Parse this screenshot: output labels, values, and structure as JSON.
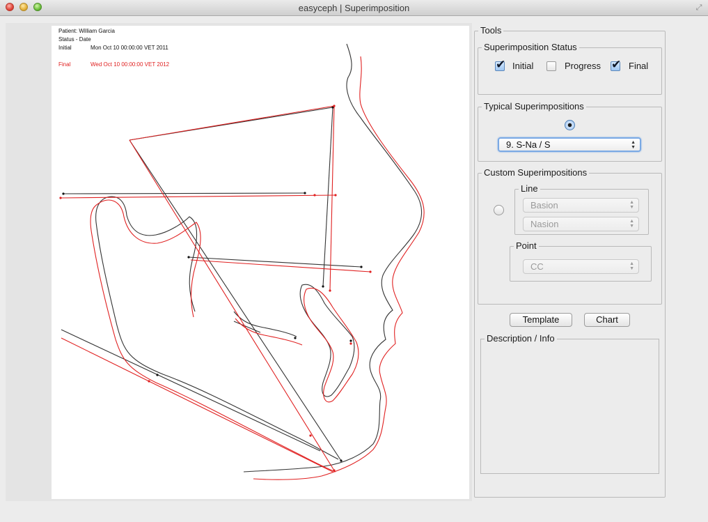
{
  "window": {
    "title": "easyceph | Superimposition"
  },
  "tracing": {
    "patient_line": "Patient: William Garcia",
    "status_line": "Status  -  Date",
    "initial_label": "Initial",
    "initial_date": "Mon Oct 10 00:00:00 VET 2011",
    "final_label": "Final",
    "final_date": "Wed Oct 10 00:00:00 VET 2012",
    "colors": {
      "initial": "#333333",
      "final": "#e02020"
    }
  },
  "tools": {
    "title": "Tools",
    "status": {
      "title": "Superimposition Status",
      "initial": {
        "label": "Initial",
        "checked": true
      },
      "progress": {
        "label": "Progress",
        "checked": false
      },
      "final": {
        "label": "Final",
        "checked": true
      }
    },
    "typical": {
      "title": "Typical Superimpositions",
      "selected": true,
      "value": "9. S-Na / S"
    },
    "custom": {
      "title": "Custom Superimpositions",
      "selected": false,
      "line_title": "Line",
      "line_from": "Basion",
      "line_to": "Nasion",
      "point_title": "Point",
      "point_value": "CC"
    },
    "template_button": "Template",
    "chart_button": "Chart",
    "description": {
      "title": "Description / Info",
      "text": ""
    }
  }
}
